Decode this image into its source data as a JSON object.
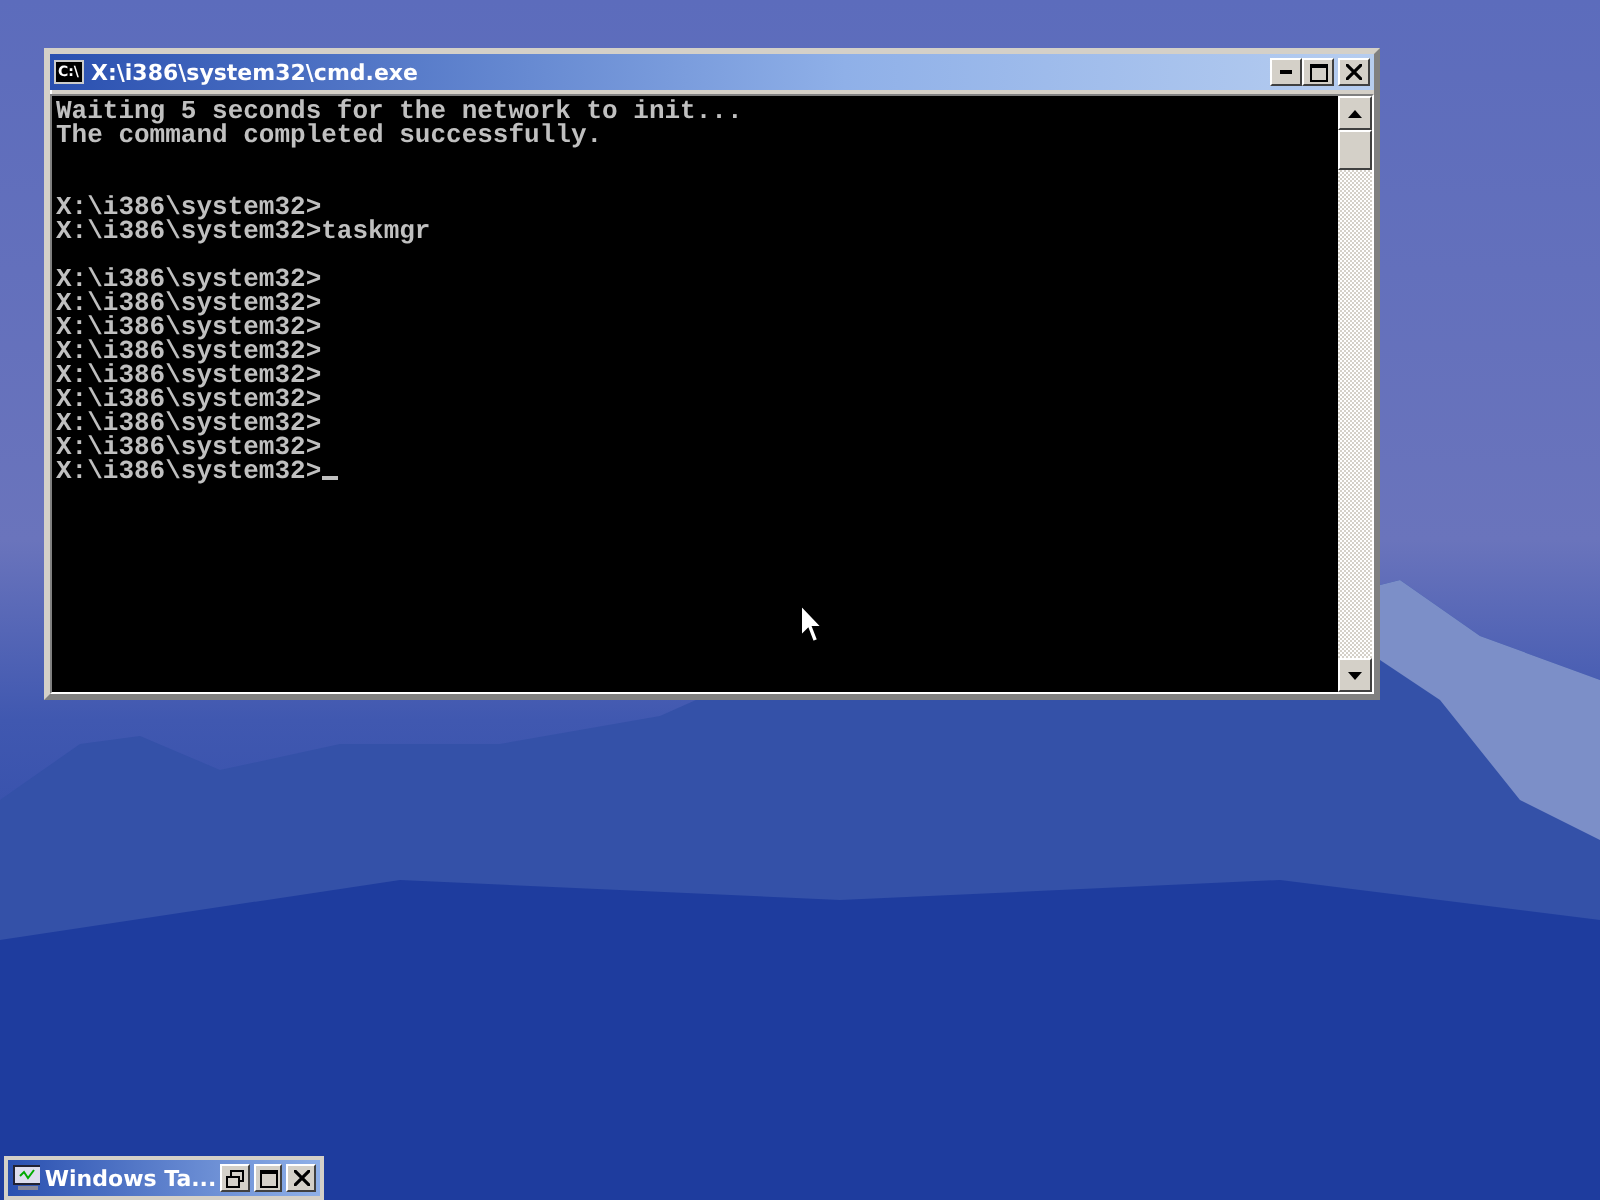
{
  "window": {
    "title": "X:\\i386\\system32\\cmd.exe",
    "icon_text": "C:\\"
  },
  "console": {
    "lines": [
      {
        "kind": "text",
        "text": "Waiting 5 seconds for the network to init...",
        "cursor": false
      },
      {
        "kind": "text",
        "text": "The command completed successfully.",
        "cursor": false
      },
      {
        "kind": "blank"
      },
      {
        "kind": "blank"
      },
      {
        "kind": "text",
        "text": "X:\\i386\\system32>",
        "cursor": false
      },
      {
        "kind": "text",
        "text": "X:\\i386\\system32>taskmgr",
        "cursor": false
      },
      {
        "kind": "blank"
      },
      {
        "kind": "text",
        "text": "X:\\i386\\system32>",
        "cursor": false
      },
      {
        "kind": "text",
        "text": "X:\\i386\\system32>",
        "cursor": false
      },
      {
        "kind": "text",
        "text": "X:\\i386\\system32>",
        "cursor": false
      },
      {
        "kind": "text",
        "text": "X:\\i386\\system32>",
        "cursor": false
      },
      {
        "kind": "text",
        "text": "X:\\i386\\system32>",
        "cursor": false
      },
      {
        "kind": "text",
        "text": "X:\\i386\\system32>",
        "cursor": false
      },
      {
        "kind": "text",
        "text": "X:\\i386\\system32>",
        "cursor": false
      },
      {
        "kind": "text",
        "text": "X:\\i386\\system32>",
        "cursor": false
      },
      {
        "kind": "text",
        "text": "X:\\i386\\system32>",
        "cursor": true
      }
    ]
  },
  "minimized_window": {
    "title": "Windows Ta..."
  }
}
